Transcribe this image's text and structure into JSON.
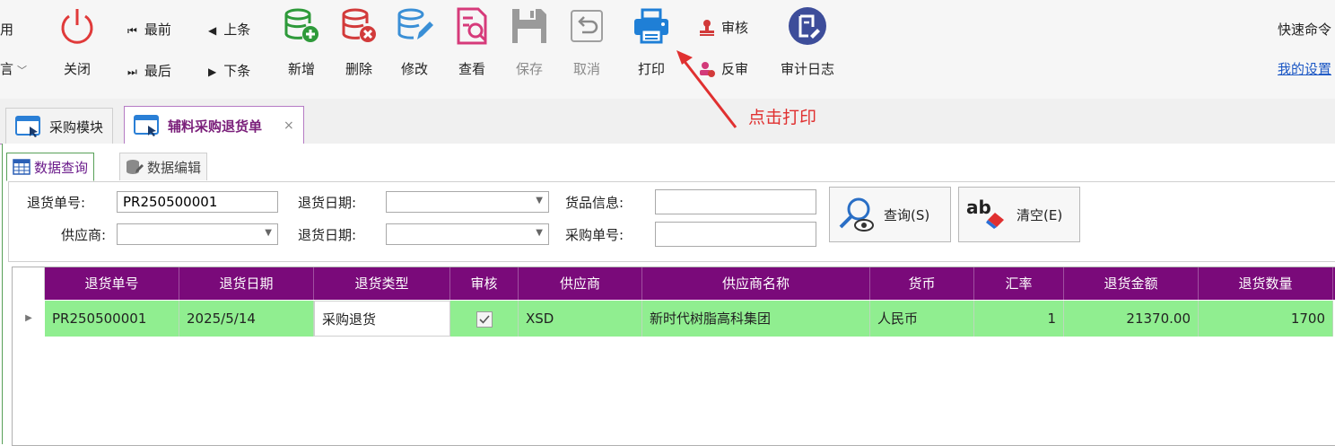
{
  "toolbar": {
    "left_partial_top": "用",
    "left_partial_bottom": "言",
    "close_label": "关闭",
    "nav_first": "最前",
    "nav_prev": "上条",
    "nav_last": "最后",
    "nav_next": "下条",
    "add_label": "新增",
    "delete_label": "删除",
    "edit_label": "修改",
    "view_label": "查看",
    "save_label": "保存",
    "cancel_label": "取消",
    "print_label": "打印",
    "audit_label": "审核",
    "unaudit_label": "反审",
    "audit_log_label": "审计日志",
    "quick_cmd_label": "快速命令",
    "my_settings_label": "我的设置"
  },
  "doc_tabs": [
    {
      "label": "采购模块"
    },
    {
      "label": "辅料采购退货单",
      "close": "×"
    }
  ],
  "sub_tabs": [
    {
      "label": "数据查询"
    },
    {
      "label": "数据编辑"
    }
  ],
  "search": {
    "return_no_label": "退货单号:",
    "return_no_value": "PR250500001",
    "supplier_label": "供应商:",
    "supplier_value": "",
    "return_date1_label": "退货日期:",
    "return_date1_value": "",
    "return_date2_label": "退货日期:",
    "return_date2_value": "",
    "goods_info_label": "货品信息:",
    "goods_info_value": "",
    "purchase_no_label": "采购单号:",
    "purchase_no_value": "",
    "query_button": "查询(S)",
    "clear_button": "清空(E)",
    "clear_icon_text": "ab"
  },
  "grid": {
    "columns": [
      "退货单号",
      "退货日期",
      "退货类型",
      "审核",
      "供应商",
      "供应商名称",
      "货币",
      "汇率",
      "退货金额",
      "退货数量"
    ],
    "rows": [
      {
        "return_no": "PR250500001",
        "return_date": "2025/5/14",
        "return_type": "采购退货",
        "audited": true,
        "supplier": "XSD",
        "supplier_name": "新时代树脂高科集团",
        "currency": "人民币",
        "rate": "1",
        "amount": "21370.00",
        "quantity": "1700"
      }
    ]
  },
  "annotation": {
    "text": "点击打印",
    "color": "#e03030"
  },
  "colors": {
    "header_purple": "#7a0a7a",
    "row_green": "#90ee90",
    "link_blue": "#1a56c4"
  }
}
